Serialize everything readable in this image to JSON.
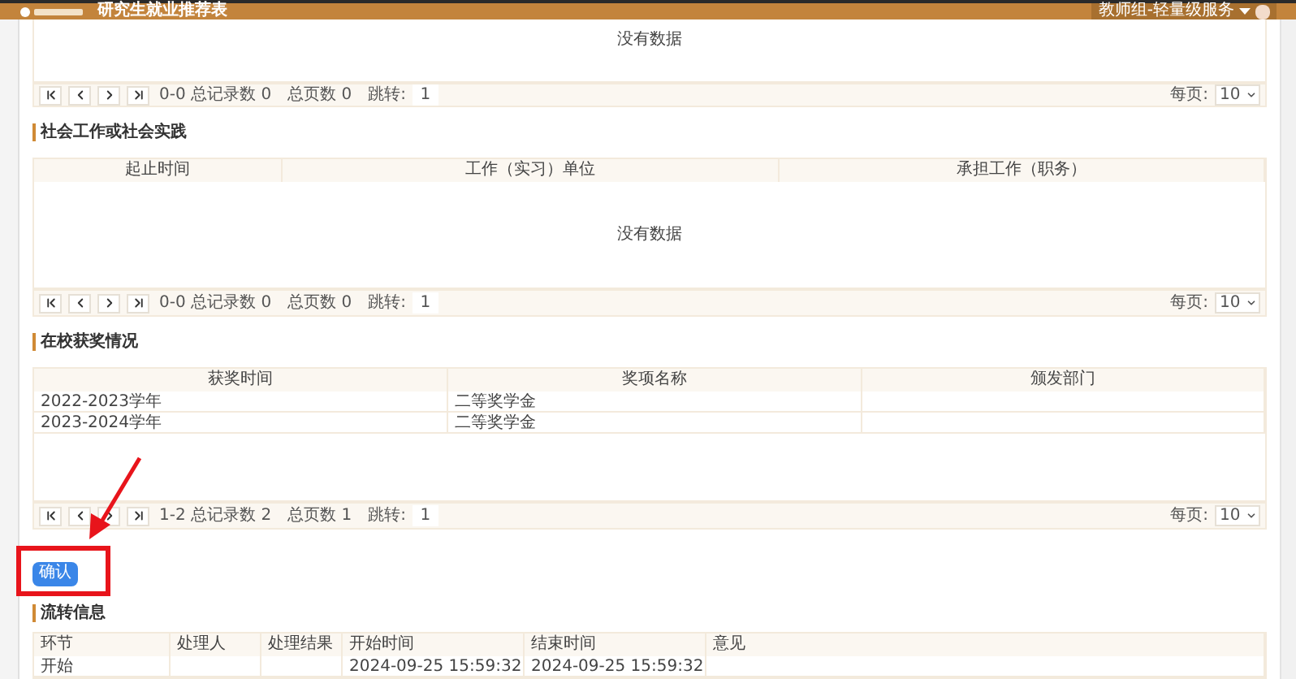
{
  "header": {
    "title": "研究生就业推荐表",
    "user": "教师组-轻量级服务"
  },
  "top_table": {
    "empty_text": "没有数据",
    "pagination": {
      "range": "0-0 总记录数 0",
      "pages": "总页数 0",
      "jump_label": "跳转:",
      "jump_value": "1",
      "per_page_label": "每页:",
      "per_page_value": "10"
    }
  },
  "sections": [
    {
      "title": "社会工作或社会实践",
      "columns": [
        "起止时间",
        "工作（实习）单位",
        "承担工作（职务）"
      ],
      "empty_text": "没有数据",
      "pagination": {
        "range": "0-0 总记录数 0",
        "pages": "总页数 0",
        "jump_label": "跳转:",
        "jump_value": "1",
        "per_page_label": "每页:",
        "per_page_value": "10"
      }
    },
    {
      "title": "在校获奖情况",
      "columns": [
        "获奖时间",
        "奖项名称",
        "颁发部门"
      ],
      "rows": [
        [
          "2022-2023学年",
          "二等奖学金",
          ""
        ],
        [
          "2023-2024学年",
          "二等奖学金",
          ""
        ]
      ],
      "pagination": {
        "range": "1-2 总记录数 2",
        "pages": "总页数 1",
        "jump_label": "跳转:",
        "jump_value": "1",
        "per_page_label": "每页:",
        "per_page_value": "10"
      }
    }
  ],
  "confirm_button": "确认",
  "flow": {
    "title": "流转信息",
    "columns": [
      "环节",
      "处理人",
      "处理结果",
      "开始时间",
      "结束时间",
      "意见"
    ],
    "rows": [
      [
        "开始",
        "",
        "",
        "2024-09-25 15:59:32",
        "2024-09-25 15:59:32",
        ""
      ]
    ]
  }
}
